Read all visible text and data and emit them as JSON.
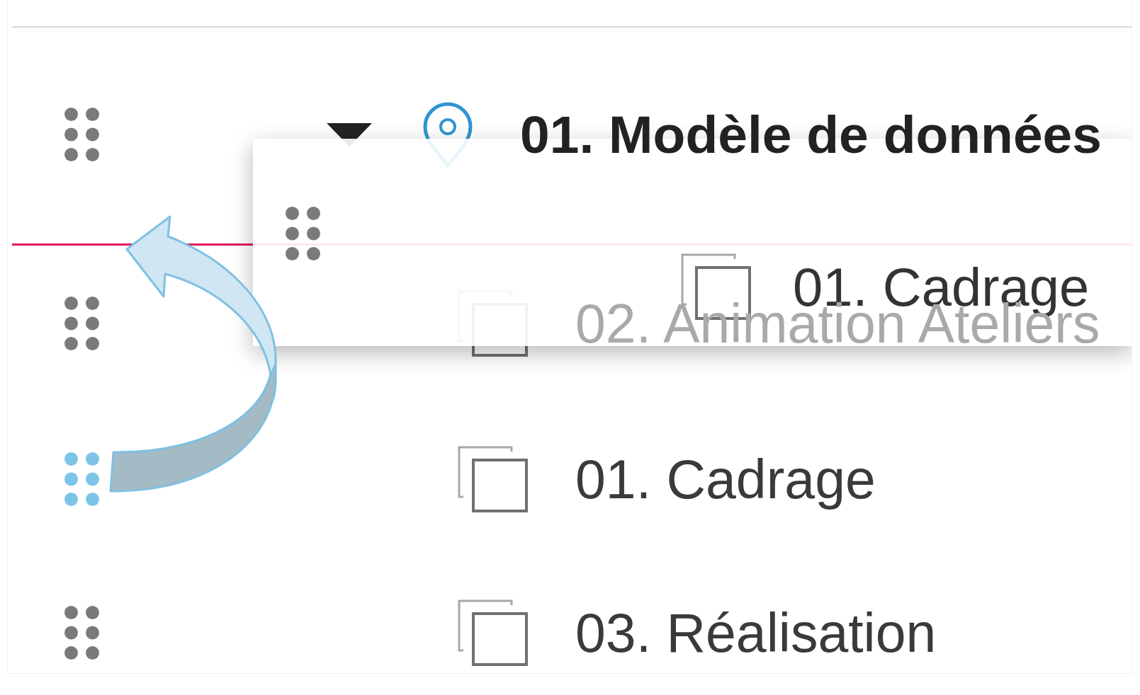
{
  "list": {
    "items": [
      {
        "kind": "group",
        "label": "01. Modèle de données",
        "expanded": true,
        "dragging": false,
        "children": [
          {
            "kind": "page",
            "label": "02. Animation Ateliers",
            "dragging": false
          },
          {
            "kind": "page",
            "label": "01. Cadrage",
            "dragging": true
          },
          {
            "kind": "page",
            "label": "03. Réalisation",
            "dragging": false
          }
        ]
      }
    ]
  },
  "drop_line": true,
  "drag_preview": {
    "kind": "page",
    "label": "01. Cadrage"
  }
}
